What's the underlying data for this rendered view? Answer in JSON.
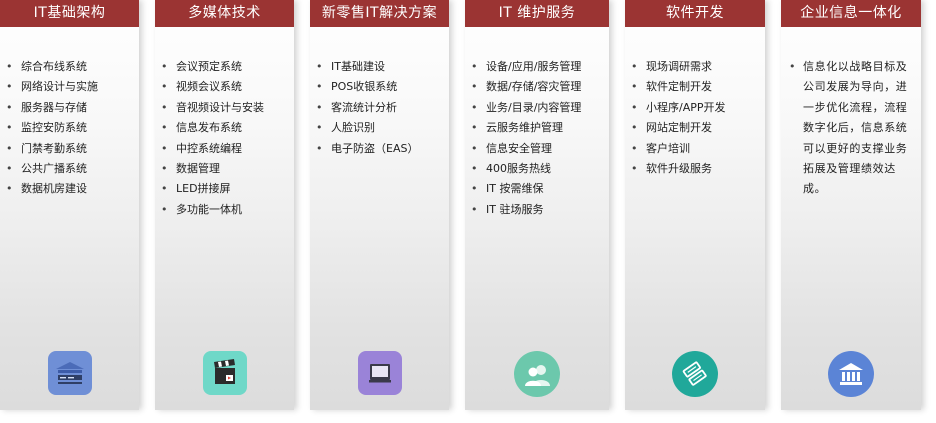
{
  "columns": [
    {
      "title": "IT基础架构",
      "items": [
        "综合布线系统",
        "网络设计与实施",
        "服务器与存储",
        "监控安防系统",
        "门禁考勤系统",
        "公共广播系统",
        "数据机房建设"
      ],
      "icon": "server-rack-icon",
      "icon_color": "#6f8fd6"
    },
    {
      "title": "多媒体技术",
      "items": [
        "会议预定系统",
        "视频会议系统",
        "音视频设计与安装",
        "信息发布系统",
        "中控系统编程",
        "数据管理",
        "LED拼接屏",
        "多功能一体机"
      ],
      "icon": "clapperboard-icon",
      "icon_color": "#6fd8c8"
    },
    {
      "title": "新零售IT解决方案",
      "items": [
        "IT基础建设",
        "POS收银系统",
        "客流统计分析",
        "人脸识别",
        "电子防盗（EAS）"
      ],
      "icon": "monitor-icon",
      "icon_color": "#9a83d8"
    },
    {
      "title": "IT 维护服务",
      "items": [
        "设备/应用/服务管理",
        "数据/存储/容灾管理",
        "业务/目录/内容管理",
        "云服务维护管理",
        "信息安全管理",
        "400服务热线",
        "IT 按需维保",
        "IT 驻场服务"
      ],
      "icon": "users-icon",
      "icon_color": "#6cc8ac"
    },
    {
      "title": "软件开发",
      "items": [
        "现场调研需求",
        "软件定制开发",
        "小程序/APP开发",
        "网站定制开发",
        "客户培训",
        "软件升级服务"
      ],
      "icon": "tools-icon",
      "icon_color": "#20a89a"
    },
    {
      "title": "企业信息一体化",
      "paragraph": "信息化以战略目标及公司发展为导向，进一步优化流程，流程数字化后，信息系统可以更好的支撑业务拓展及管理绩效达成。",
      "icon": "bank-building-icon",
      "icon_color": "#5b84d6"
    }
  ],
  "colors": {
    "header_bg": "#9b3433",
    "header_text": "#ffffff",
    "body_text": "#222222"
  }
}
